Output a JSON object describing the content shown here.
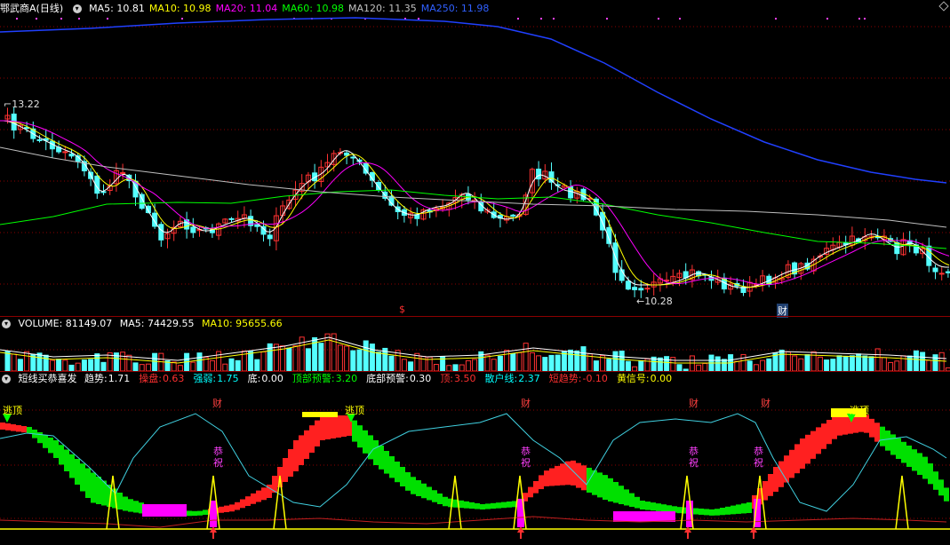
{
  "main_header": {
    "stock_name": "鄂武商A",
    "period": "(日线)",
    "indicators": [
      {
        "label": "MA5: 10.81",
        "color": "#ffffff"
      },
      {
        "label": "MA10: 10.98",
        "color": "#ffff00"
      },
      {
        "label": "MA20: 11.04",
        "color": "#ff00ff"
      },
      {
        "label": "MA60: 10.98",
        "color": "#00ff00"
      },
      {
        "label": "MA120: 11.35",
        "color": "#c0c0c0"
      },
      {
        "label": "MA250: 11.98",
        "color": "#3060ff"
      }
    ]
  },
  "price_labels": {
    "high": "13.22",
    "low": "10.28"
  },
  "markers": {
    "s_mark": "$",
    "cai_mark": "财"
  },
  "volume_header": {
    "label": "VOLUME: 81149.07",
    "ma5": "MA5: 74429.55",
    "ma10": "MA10: 95655.66"
  },
  "indicator_header": {
    "name": "短线买恭喜发",
    "items": [
      {
        "key": "趋势:",
        "value": "1.71",
        "color": "#ffffff"
      },
      {
        "key": "操盘:",
        "value": "0.63",
        "color": "#ff3030"
      },
      {
        "key": "强弱:",
        "value": "1.75",
        "color": "#00ffff"
      },
      {
        "key": "底:",
        "value": "0.00",
        "color": "#ffffff"
      },
      {
        "key": "顶部预警:",
        "value": "3.20",
        "color": "#00ff00"
      },
      {
        "key": "底部预警:",
        "value": "0.30",
        "color": "#ffffff"
      },
      {
        "key": "顶:",
        "value": "3.50",
        "color": "#ff3030"
      },
      {
        "key": "散户线:",
        "value": "2.37",
        "color": "#00ffff"
      },
      {
        "key": "短趋势:",
        "value": "-0.10",
        "color": "#ff3030"
      },
      {
        "key": "黄信号:",
        "value": "0.00",
        "color": "#ffff00"
      }
    ]
  },
  "signals": {
    "escape_top": "逃顶",
    "cai": "财",
    "gong": "恭",
    "zhu": "祝"
  },
  "colors": {
    "up": "#ff3232",
    "down": "#54ffff",
    "grid": "#8b0000"
  }
}
